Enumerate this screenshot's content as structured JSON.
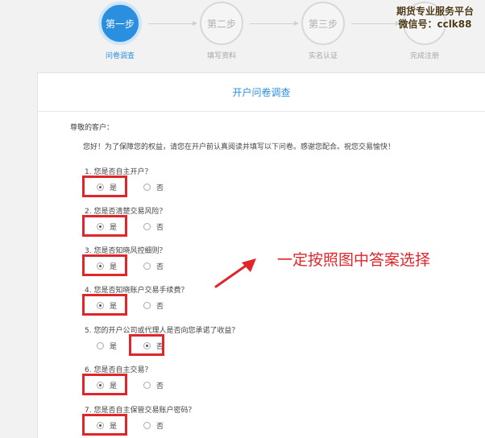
{
  "steps": [
    {
      "circle": "第一步",
      "label": "问卷调查"
    },
    {
      "circle": "第二步",
      "label": "填写资料"
    },
    {
      "circle": "第三步",
      "label": "实名认证"
    },
    {
      "circle": "",
      "label": "完成注册"
    }
  ],
  "watermark": {
    "line1": "期货专业服务平台",
    "line2": "微信号：cclk88"
  },
  "card": {
    "title": "开户问卷调查",
    "greeting": "尊敬的客户：",
    "intro": "您好！为了保障您的权益，请您在开户前认真阅读并填写以下问卷。感谢您配合。祝您交易愉快！"
  },
  "questions": [
    {
      "text": "1. 您是否自主开户？",
      "yes": "是",
      "no": "否",
      "selected": "yes"
    },
    {
      "text": "2. 您是否清楚交易风险？",
      "yes": "是",
      "no": "否",
      "selected": "yes"
    },
    {
      "text": "3. 您是否知晓风控细则？",
      "yes": "是",
      "no": "否",
      "selected": "yes"
    },
    {
      "text": "4. 您是否知晓账户交易手续费？",
      "yes": "是",
      "no": "否",
      "selected": "yes"
    },
    {
      "text": "5. 您的开户公司或代理人是否向您承诺了收益？",
      "yes": "是",
      "no": "否",
      "selected": "no"
    },
    {
      "text": "6. 您是否自主交易？",
      "yes": "是",
      "no": "否",
      "selected": "yes"
    },
    {
      "text": "7. 您是否自主保管交易账户密码？",
      "yes": "是",
      "no": "否",
      "selected": "yes"
    }
  ],
  "annotation": {
    "text": "一定按照图中答案选择",
    "color": "#e0252b"
  },
  "colors": {
    "accent": "#2b8fe0",
    "highlight": "#e0252b"
  }
}
